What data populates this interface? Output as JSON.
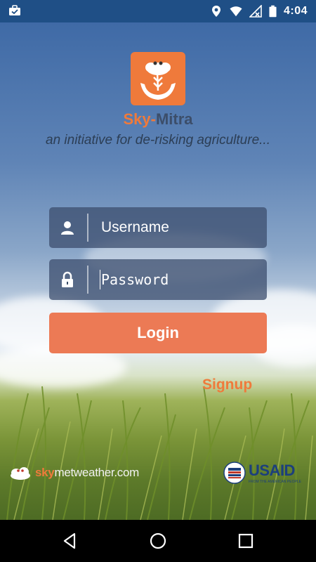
{
  "status_bar": {
    "time": "4:04",
    "icons": [
      "briefcase-check-icon",
      "location-icon",
      "wifi-icon",
      "no-signal-icon",
      "battery-icon"
    ]
  },
  "app": {
    "brand_sky": "Sky",
    "brand_dash": "-",
    "brand_mitra": "Mitra",
    "tagline": "an initiative for de-risking agriculture...",
    "accent_color": "#ef7a3b"
  },
  "form": {
    "username_placeholder": "Username",
    "password_placeholder": "Password",
    "login_label": "Login",
    "signup_label": "Signup"
  },
  "partners": {
    "left_sky": "sky",
    "left_rest": "metweather.com",
    "right_name": "USAID",
    "right_sub": "FROM THE AMERICAN PEOPLE"
  },
  "nav": {
    "icons": [
      "back-icon",
      "home-icon",
      "recents-icon"
    ]
  }
}
